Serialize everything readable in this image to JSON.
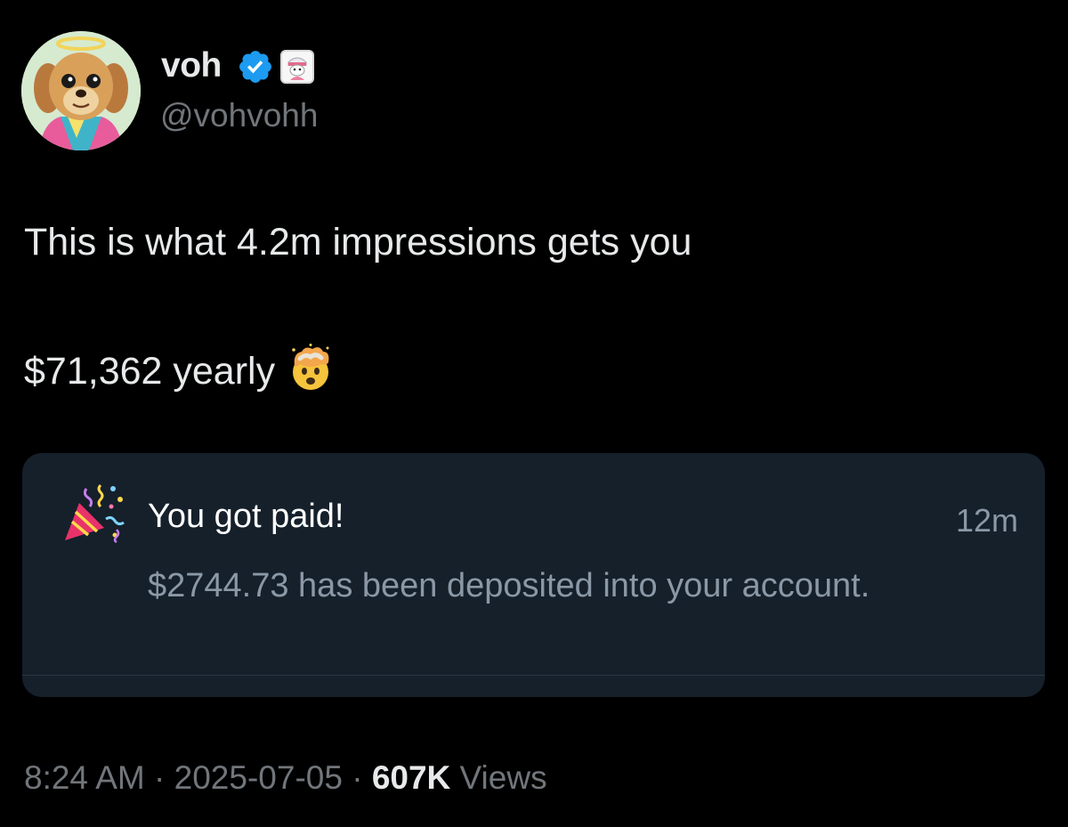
{
  "author": {
    "display_name": "voh",
    "handle": "@vohvohh",
    "avatar_icon": "dog-avatar-with-halo",
    "verified_icon": "verified-check-icon",
    "affiliate_icon": "affiliate-badge-icon"
  },
  "tweet": {
    "line1": "This is what 4.2m impressions gets you",
    "line2": "$71,362 yearly",
    "emoji": "exploding-head-emoji"
  },
  "notification_card": {
    "icon": "party-popper-icon",
    "title": "You got paid!",
    "time": "12m",
    "body": "$2744.73 has been deposited into your account."
  },
  "meta": {
    "time": "8:24 AM",
    "separator": " · ",
    "date": "2025-07-05",
    "views_count": "607K",
    "views_label": " Views"
  },
  "colors": {
    "background": "#000000",
    "card_background": "#15202b",
    "primary_text": "#e7e9ea",
    "secondary_text": "#71767b",
    "verified_blue": "#1d9bf0"
  }
}
